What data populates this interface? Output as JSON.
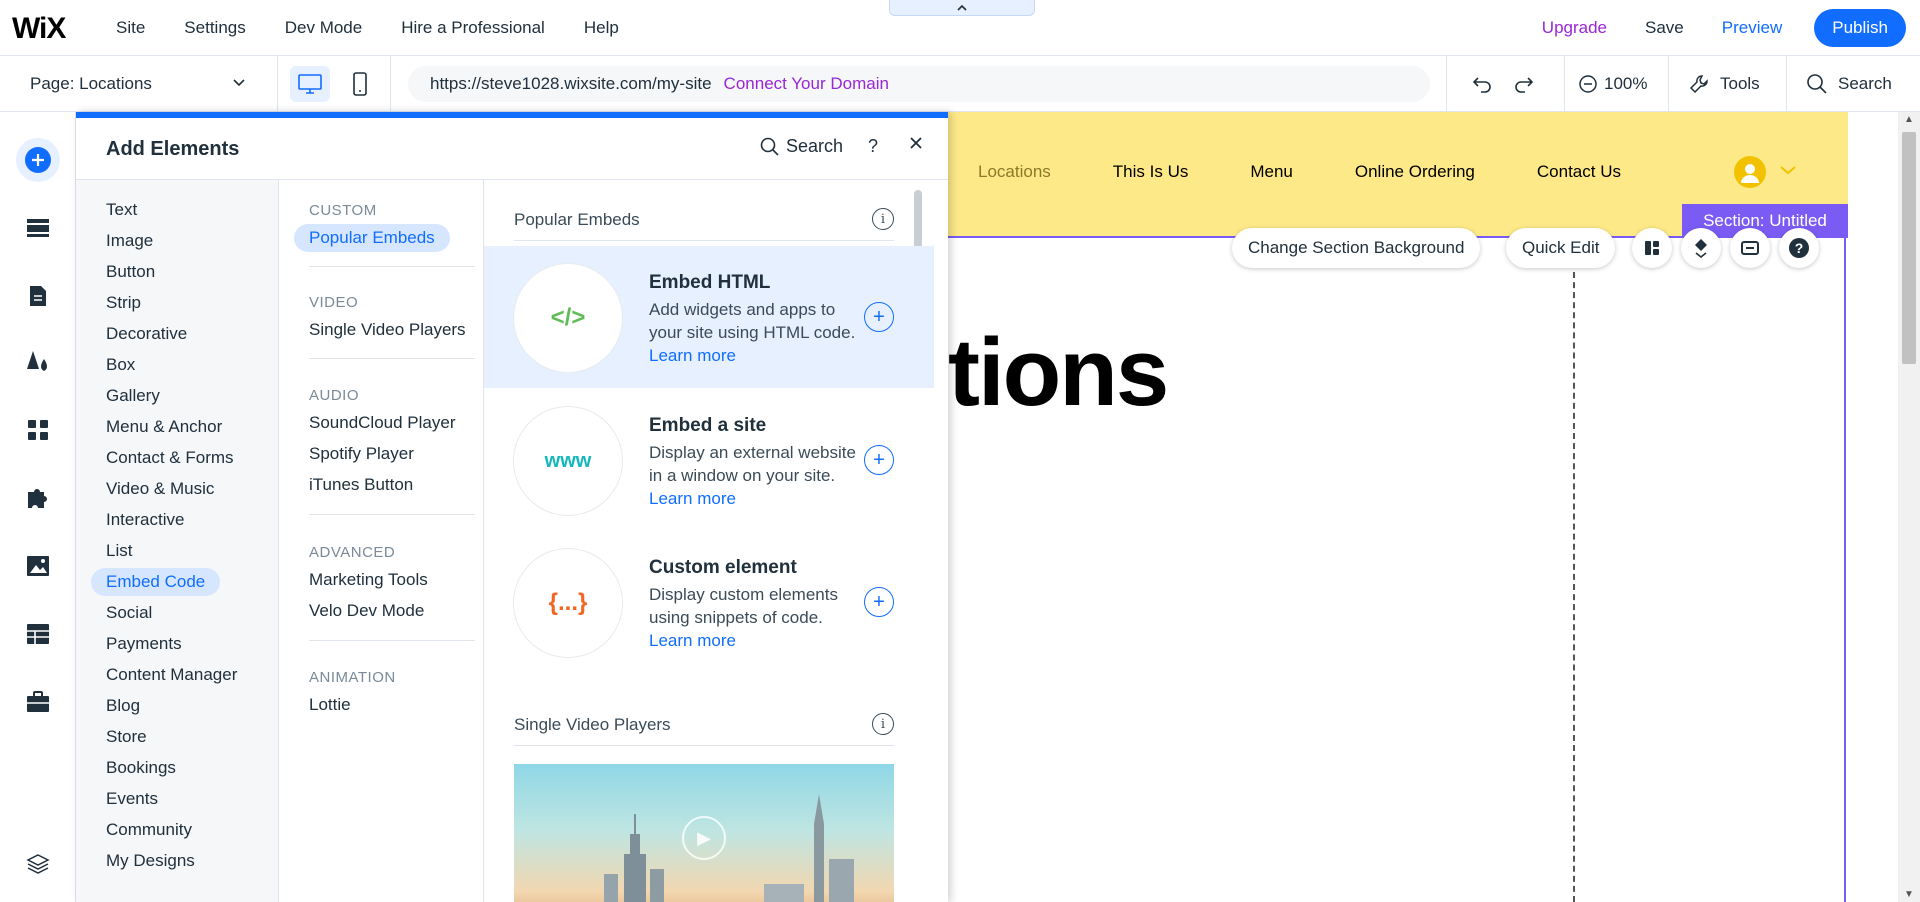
{
  "topbar": {
    "logo": "WiX",
    "nav": [
      "Site",
      "Settings",
      "Dev Mode",
      "Hire a Professional",
      "Help"
    ],
    "upgrade": "Upgrade",
    "save": "Save",
    "preview": "Preview",
    "publish": "Publish",
    "collapse_icon": "chevron-up-icon",
    "colors": {
      "accent": "#116dff",
      "upgrade": "#9a27d5"
    }
  },
  "secondbar": {
    "page_label": "Page: Locations",
    "url": "https://steve1028.wixsite.com/my-site",
    "connect": "Connect Your Domain",
    "zoom": "100%",
    "tools": "Tools",
    "search": "Search"
  },
  "panel": {
    "title": "Add Elements",
    "search": "Search",
    "help": "?",
    "categories": [
      "Text",
      "Image",
      "Button",
      "Strip",
      "Decorative",
      "Box",
      "Gallery",
      "Menu & Anchor",
      "Contact & Forms",
      "Video & Music",
      "Interactive",
      "List",
      "Embed Code",
      "Social",
      "Payments",
      "Content Manager",
      "Blog",
      "Store",
      "Bookings",
      "Events",
      "Community",
      "My Designs"
    ],
    "active_category": "Embed Code",
    "subgroups": [
      {
        "heading": "CUSTOM",
        "items": [
          "Popular Embeds"
        ]
      },
      {
        "heading": "VIDEO",
        "items": [
          "Single Video Players"
        ]
      },
      {
        "heading": "AUDIO",
        "items": [
          "SoundCloud Player",
          "Spotify Player",
          "iTunes Button"
        ]
      },
      {
        "heading": "ADVANCED",
        "items": [
          "Marketing Tools",
          "Velo Dev Mode"
        ]
      },
      {
        "heading": "ANIMATION",
        "items": [
          "Lottie"
        ]
      }
    ],
    "active_sub": "Popular Embeds",
    "sections": {
      "popular": "Popular Embeds",
      "video": "Single Video Players"
    },
    "embeds": [
      {
        "glyph": "</>",
        "name": "Embed HTML",
        "desc": "Add widgets and apps to your site using HTML code.",
        "learn": "Learn more",
        "color": "#60bc57"
      },
      {
        "glyph": "www",
        "name": "Embed a site",
        "desc": "Display an external website in a window on your site.",
        "learn": "Learn more",
        "color": "#14b7bd"
      },
      {
        "glyph": "{...}",
        "name": "Custom element",
        "desc": "Display custom elements using snippets of code.",
        "learn": "Learn more",
        "color": "#f26522"
      }
    ]
  },
  "canvas": {
    "nav": [
      "Locations",
      "This Is Us",
      "Menu",
      "Online Ordering",
      "Contact Us"
    ],
    "current_nav": "Locations",
    "section_label": "Section: Untitled",
    "change_bg": "Change Section Background",
    "quick_edit": "Quick Edit",
    "hero": "tions",
    "colors": {
      "header_bg": "#fde987",
      "section_outline": "#7a5cf5"
    }
  }
}
